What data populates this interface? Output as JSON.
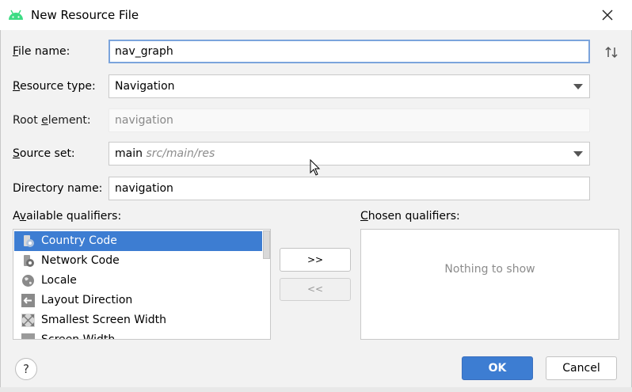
{
  "window": {
    "title": "New Resource File",
    "close_icon": "close-icon",
    "app_icon": "android-icon"
  },
  "form": {
    "file_name": {
      "label_u": "F",
      "label_rest": "ile name:",
      "value": "nav_graph"
    },
    "resource_type": {
      "label_u": "R",
      "label_rest": "esource type:",
      "value": "Navigation"
    },
    "root_element": {
      "label_pre": "Root ",
      "label_u": "e",
      "label_rest": "lement:",
      "value": "navigation"
    },
    "source_set": {
      "label_u": "S",
      "label_rest": "ource set:",
      "value": "main",
      "hint": "src/main/res"
    },
    "directory_name": {
      "label": "Directory name:",
      "value": "navigation"
    }
  },
  "qualifiers": {
    "available_label_pre": "A",
    "available_label_u": "v",
    "available_label_rest": "ailable qualifiers:",
    "chosen_label_u": "C",
    "chosen_label_rest": "hosen qualifiers:",
    "items": [
      {
        "label": "Country Code",
        "icon": "country-code-icon",
        "selected": true
      },
      {
        "label": "Network Code",
        "icon": "network-code-icon",
        "selected": false
      },
      {
        "label": "Locale",
        "icon": "globe-icon",
        "selected": false
      },
      {
        "label": "Layout Direction",
        "icon": "layout-direction-icon",
        "selected": false
      },
      {
        "label": "Smallest Screen Width",
        "icon": "smallest-screen-width-icon",
        "selected": false
      },
      {
        "label": "Screen Width",
        "icon": "screen-width-icon",
        "selected": false
      }
    ],
    "add_button": ">>",
    "remove_button": "<<",
    "chosen_empty": "Nothing to show"
  },
  "footer": {
    "help": "?",
    "ok": "OK",
    "cancel": "Cancel"
  },
  "colors": {
    "accent": "#3d7dd2",
    "android_green": "#3ddc84"
  }
}
